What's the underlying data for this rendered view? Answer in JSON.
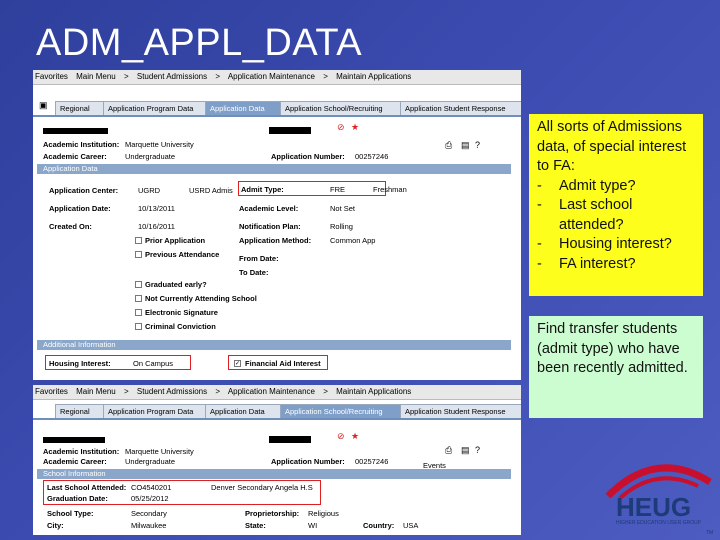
{
  "slide": {
    "title": "ADM_APPL_DATA"
  },
  "screen1": {
    "nav": [
      "Favorites",
      "Main Menu",
      ">",
      "Student Admissions",
      ">",
      "Application Maintenance",
      ">",
      "Maintain Applications"
    ],
    "tabs": [
      "Regional",
      "Application Program Data",
      "Application Data",
      "Application School/Recruiting",
      "Application Student Response"
    ],
    "active_tab": 2,
    "academic_institution_label": "Academic Institution:",
    "academic_institution_value": "Marquette University",
    "academic_career_label": "Academic Career:",
    "academic_career_value": "Undergraduate",
    "application_number_label": "Application Number:",
    "application_number_value": "00257246",
    "section_application_data": "Application Data",
    "application_center_label": "Application Center:",
    "application_center_value": "UGRD",
    "application_center_desc": "USRD Admis",
    "admit_type_label": "Admit Type:",
    "admit_type_value": "FRE",
    "admit_type_desc": "Freshman",
    "application_date_label": "Application Date:",
    "application_date_value": "10/13/2011",
    "academic_level_label": "Academic Level:",
    "academic_level_value": "Not Set",
    "created_on_label": "Created On:",
    "created_on_value": "10/16/2011",
    "notification_plan_label": "Notification Plan:",
    "notification_plan_value": "Rolling",
    "prior_application_label": "Prior Application",
    "application_method_label": "Application Method:",
    "application_method_value": "Common App",
    "previous_attendance_label": "Previous Attendance",
    "from_date_label": "From Date:",
    "to_date_label": "To Date:",
    "checkboxes": [
      "Graduated early?",
      "Not Currently Attending School",
      "Electronic Signature",
      "Criminal Conviction"
    ],
    "section_additional_info": "Additional Information",
    "housing_interest_label": "Housing Interest:",
    "housing_interest_value": "On Campus",
    "financial_aid_interest_label": "Financial Aid Interest",
    "financial_aid_checked": true
  },
  "screen2": {
    "nav": [
      "Favorites",
      "Main Menu",
      ">",
      "Student Admissions",
      ">",
      "Application Maintenance",
      ">",
      "Maintain Applications"
    ],
    "tabs": [
      "Regional",
      "Application Program Data",
      "Application Data",
      "Application School/Recruiting",
      "Application Student Response"
    ],
    "active_tab": 3,
    "academic_institution_label": "Academic Institution:",
    "academic_institution_value": "Marquette University",
    "academic_career_label": "Academic Career:",
    "academic_career_value": "Undergraduate",
    "application_number_label": "Application Number:",
    "application_number_value": "00257246",
    "events_label": "Events",
    "section_school_info": "School Information",
    "last_school_attended_label": "Last School Attended:",
    "last_school_attended_value": "CO4540201",
    "last_school_attended_desc": "Denver Secondary Angela H.S",
    "graduation_date_label": "Graduation Date:",
    "graduation_date_value": "05/25/2012",
    "school_type_label": "School Type:",
    "school_type_value": "Secondary",
    "proprietorship_label": "Proprietorship:",
    "proprietorship_value": "Religious",
    "city_label": "City:",
    "city_value": "Milwaukee",
    "state_label": "State:",
    "state_value": "WI",
    "country_label": "Country:",
    "country_value": "USA"
  },
  "callout1": {
    "intro": "All sorts of Admissions data, of special interest to FA:",
    "items": [
      "Admit type?",
      "Last school attended?",
      "Housing interest?",
      "FA interest?"
    ]
  },
  "callout2": {
    "text": "Find transfer students (admit type) who have been recently admitted."
  },
  "logo": {
    "name": "HEUG",
    "tagline": "HIGHER EDUCATION USER GROUP",
    "tm": "TM"
  },
  "colors": {
    "background": "#3b4bb0",
    "callout1": "#fefe1c",
    "callout2": "#ccfdd0",
    "highlight_box": "#e02020",
    "logo_red": "#c8102e",
    "logo_blue": "#1d3b78"
  }
}
